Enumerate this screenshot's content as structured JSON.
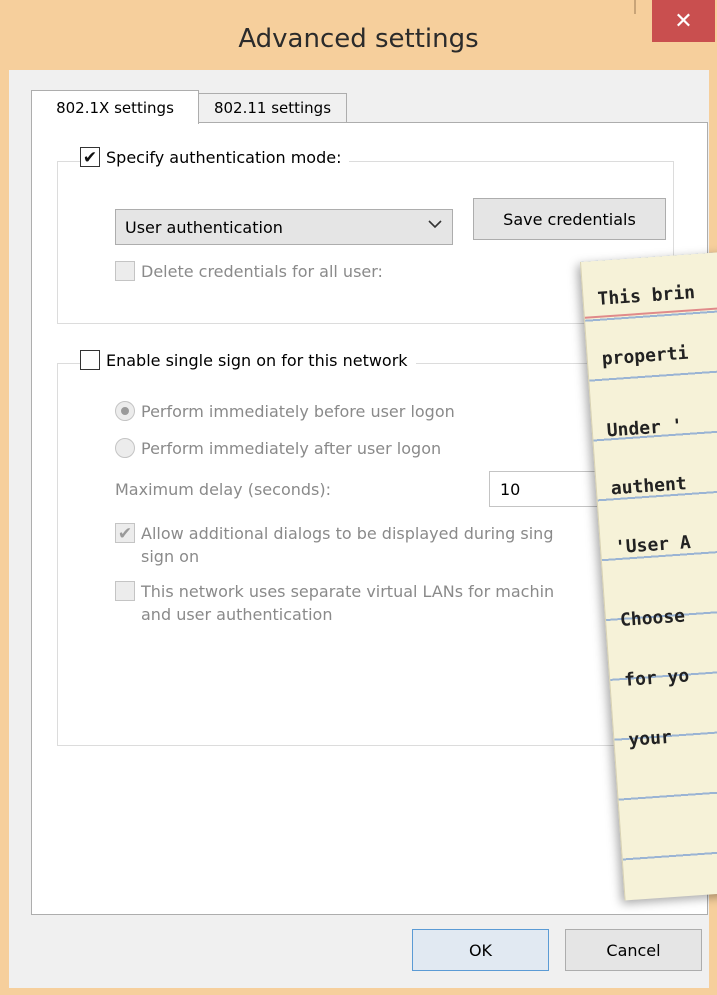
{
  "window": {
    "title": "Advanced settings",
    "close_glyph": "✕"
  },
  "tabs": [
    {
      "label": "802.1X settings",
      "active": true
    },
    {
      "label": "802.11 settings",
      "active": false
    }
  ],
  "auth_group": {
    "checkbox_label": "Specify authentication mode:",
    "checked": true,
    "select_value": "User authentication",
    "save_credentials_label": "Save credentials",
    "delete_credentials_label": "Delete credentials for all user:"
  },
  "sso_group": {
    "checkbox_label": "Enable single sign on for this network",
    "checked": false,
    "radio_before_label": "Perform immediately before user logon",
    "radio_after_label": "Perform immediately after user logon",
    "max_delay_label": "Maximum delay (seconds):",
    "max_delay_value": "10",
    "allow_dialogs_line1": "Allow additional dialogs to be displayed during sing",
    "allow_dialogs_line2": "sign on",
    "separate_vlans_line1": "This network uses separate virtual LANs for machin",
    "separate_vlans_line2": "and user authentication"
  },
  "footer": {
    "ok_label": "OK",
    "cancel_label": "Cancel"
  },
  "note": {
    "lines": [
      "This brin",
      "properti",
      "Under '",
      "authent",
      "'User A",
      "Choose",
      "for yo",
      "your "
    ]
  },
  "icons": {
    "check": "✔",
    "chevron": "⌄"
  },
  "colors": {
    "frame": "#f6cf9c",
    "close": "#c94f4f",
    "panel": "#ffffff",
    "note_paper": "#f6f2d8"
  }
}
